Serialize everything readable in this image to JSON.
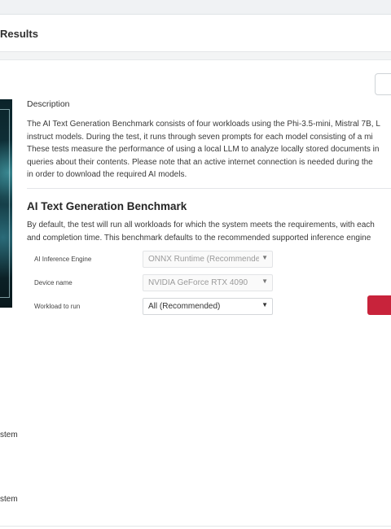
{
  "header": {
    "title": "Results"
  },
  "description": {
    "heading": "Description",
    "lines": [
      "The AI Text Generation Benchmark consists of four workloads using the Phi-3.5-mini, Mistral 7B, L",
      "instruct models. During the test, it runs through seven prompts for each model consisting of a mi",
      "These tests measure the performance of using a local LLM to analyze locally stored documents in",
      "queries about their contents. Please note that an active internet connection is needed during the",
      "in order to download the required AI models."
    ]
  },
  "benchmark": {
    "title": "AI Text Generation Benchmark",
    "lines": [
      "By default, the test will run all workloads for which the system meets the requirements, with each",
      "and completion time. This benchmark defaults to the recommended supported inference engine"
    ]
  },
  "settings": {
    "engine_label": "AI Inference Engine",
    "engine_value": "ONNX Runtime (Recommende",
    "device_label": "Device name",
    "device_value": "NVIDIA GeForce RTX 4090",
    "workload_label": "Workload to run",
    "workload_value": "All (Recommended)"
  },
  "side": {
    "item1": "stem",
    "item2": "stem"
  },
  "colors": {
    "accent": "#c8233b",
    "background": "#ffffff",
    "band": "#f3f4f5"
  },
  "icons": {
    "dropdown": "chevron-down-icon"
  }
}
